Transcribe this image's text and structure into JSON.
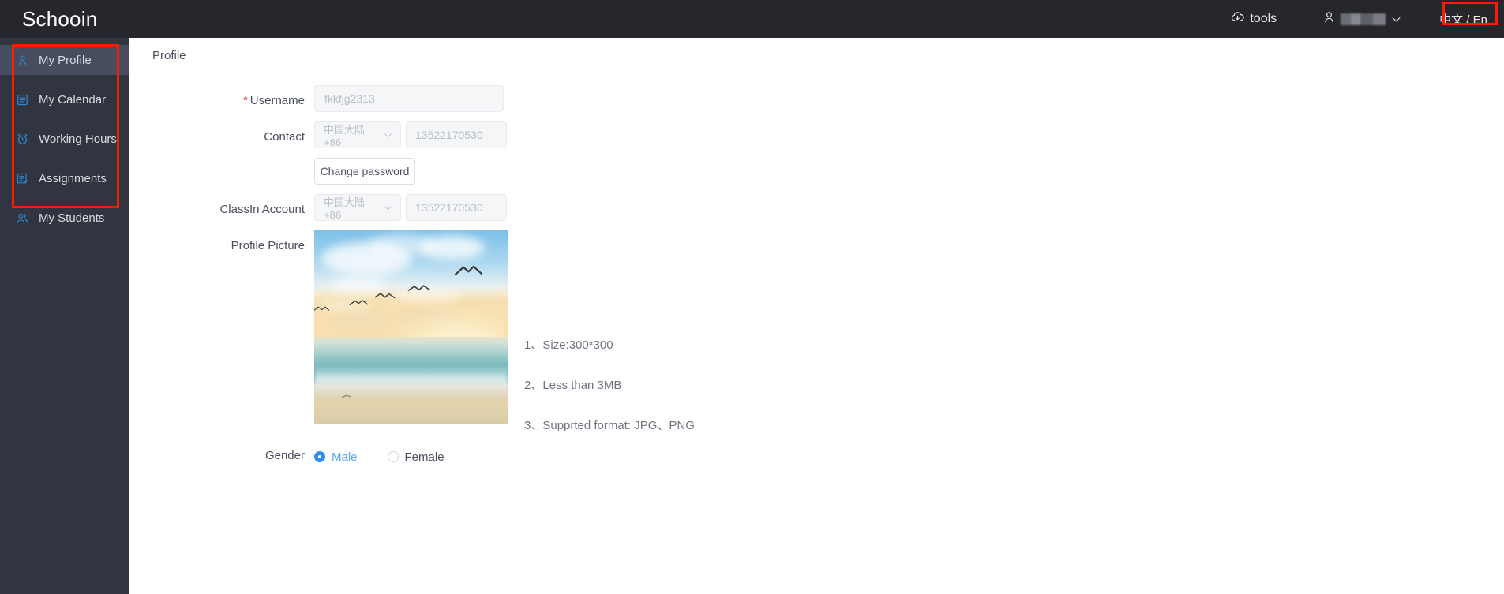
{
  "header": {
    "brand": "Schooin",
    "tools_label": "tools",
    "tools_icon": "cloud-download-icon",
    "user_icon": "user-icon",
    "user_name_redacted": "",
    "chevron_icon": "chevron-down-icon",
    "language_toggle": "中文 / En",
    "highlight_color": "#ff1a00"
  },
  "sidebar": {
    "items": [
      {
        "label": "My Profile",
        "icon": "user-icon",
        "active": true
      },
      {
        "label": "My Calendar",
        "icon": "calendar-icon",
        "active": false
      },
      {
        "label": "Working Hours",
        "icon": "alarm-clock-icon",
        "active": false
      },
      {
        "label": "Assignments",
        "icon": "document-check-icon",
        "active": false
      },
      {
        "label": "My Students",
        "icon": "users-icon",
        "active": false
      }
    ]
  },
  "main": {
    "page_title": "Profile",
    "username": {
      "label": "Username",
      "required_mark": "*",
      "value": "fkkfjg2313"
    },
    "contact": {
      "label": "Contact",
      "country": "中国大陆 +86",
      "phone": "13522170530"
    },
    "change_password_label": "Change password",
    "classin": {
      "label": "ClassIn Account",
      "country": "中国大陆 +86",
      "phone": "13522170530"
    },
    "photo": {
      "label": "Profile Picture",
      "alt": "beach-sunset-with-seagulls",
      "rules": [
        "1、Size:300*300",
        "2、Less than 3MB",
        "3、Supprted format: JPG、PNG"
      ]
    },
    "gender": {
      "label": "Gender",
      "options": [
        {
          "label": "Male",
          "selected": true
        },
        {
          "label": "Female",
          "selected": false
        }
      ]
    }
  }
}
